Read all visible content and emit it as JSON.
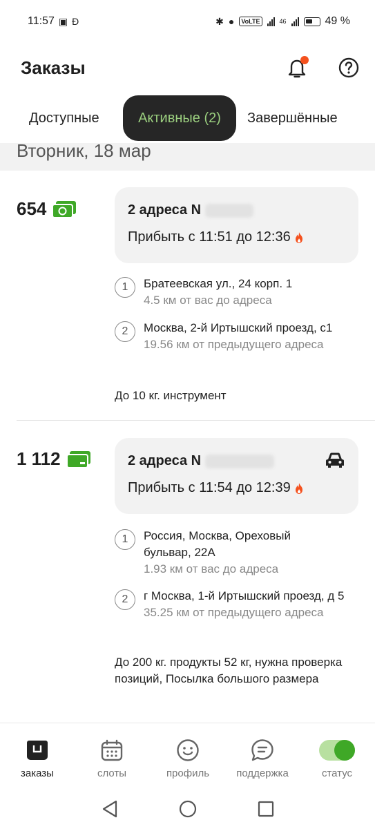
{
  "status_bar": {
    "time": "11:57",
    "network": "46",
    "battery": "49 %",
    "volte": "VoLTE"
  },
  "header": {
    "title": "Заказы",
    "icons": [
      "bell-icon",
      "help-icon"
    ]
  },
  "tabs": [
    {
      "label": "Доступные",
      "active": false
    },
    {
      "label": "Активные (2)",
      "active": true
    },
    {
      "label": "Завершённые",
      "active": false
    }
  ],
  "date_label": "Вторник, 18 мар",
  "orders": [
    {
      "price": "654",
      "payment_icon": "cash-icon",
      "title": "2 адреса N",
      "arrive": "Прибыть с 11:51 до 12:36",
      "addresses": [
        {
          "num": "1",
          "text": "Братеевская ул., 24 корп. 1",
          "dist": "4.5 км от вас до адреса"
        },
        {
          "num": "2",
          "text": "Москва, 2-й Иртышский проезд, с1",
          "dist": "19.56 км от предыдущего адреса"
        }
      ],
      "note": "До 10 кг. инструмент"
    },
    {
      "price": "1 112",
      "payment_icon": "card-icon",
      "title": "2 адреса N",
      "arrive": "Прибыть с 11:54 до 12:39",
      "addresses": [
        {
          "num": "1",
          "text": "Россия, Москва, Ореховый бульвар, 22А",
          "dist": "1.93 км от вас до адреса"
        },
        {
          "num": "2",
          "text": "г Москва, 1-й Иртышский проезд, д 5",
          "dist": "35.25 км от предыдущего адреса"
        }
      ],
      "note": "До 200 кг. продукты 52 кг, нужна проверка позиций, Посылка большого размера"
    }
  ],
  "bottom_nav": [
    {
      "label": "заказы",
      "icon": "orders-icon",
      "active": true
    },
    {
      "label": "слоты",
      "icon": "calendar-icon",
      "active": false
    },
    {
      "label": "профиль",
      "icon": "smile-icon",
      "active": false
    },
    {
      "label": "поддержка",
      "icon": "chat-icon",
      "active": false
    },
    {
      "label": "статус",
      "icon": "toggle-icon",
      "active": false
    }
  ],
  "colors": {
    "accent_green": "#3fa827",
    "active_tab_bg": "#262626",
    "active_tab_text": "#9bcf7f",
    "notification_dot": "#f4511e",
    "fire": "#f4511e"
  }
}
